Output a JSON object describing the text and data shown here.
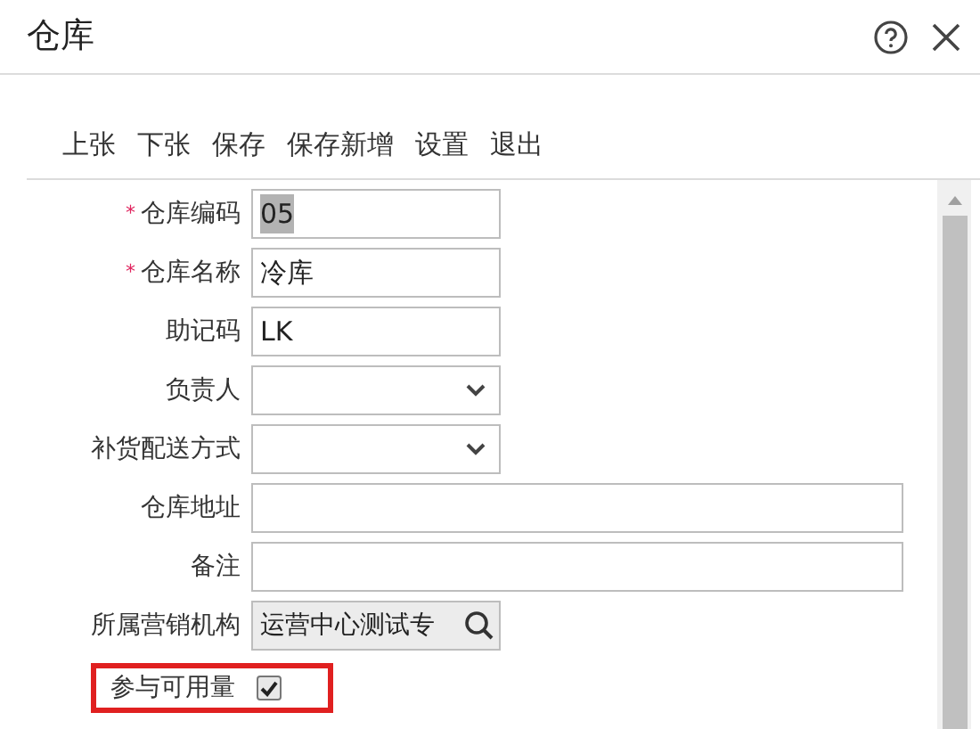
{
  "window": {
    "title": "仓库"
  },
  "toolbar": [
    "上张",
    "下张",
    "保存",
    "保存新增",
    "设置",
    "退出"
  ],
  "fields": [
    {
      "kind": "text",
      "label": "仓库编码",
      "required_mark": "*",
      "value": "05",
      "wide": false,
      "highlighted": true
    },
    {
      "kind": "text",
      "label": "仓库名称",
      "required_mark": "*",
      "value": "冷库",
      "wide": false,
      "highlighted": false
    },
    {
      "kind": "text",
      "label": "助记码",
      "value": "LK",
      "wide": false,
      "highlighted": false
    },
    {
      "kind": "select",
      "label": "负责人",
      "wide": false
    },
    {
      "kind": "select",
      "label": "补货配送方式",
      "wide": false
    },
    {
      "kind": "text",
      "label": "仓库地址",
      "wide": true
    },
    {
      "kind": "text",
      "label": "备注",
      "wide": true
    },
    {
      "kind": "lookup",
      "label": "所属营销机构",
      "value": "运营中心测试专",
      "wide": false
    },
    {
      "kind": "checkbox",
      "label": "参与可用量",
      "checked": true,
      "outlined": true
    }
  ]
}
